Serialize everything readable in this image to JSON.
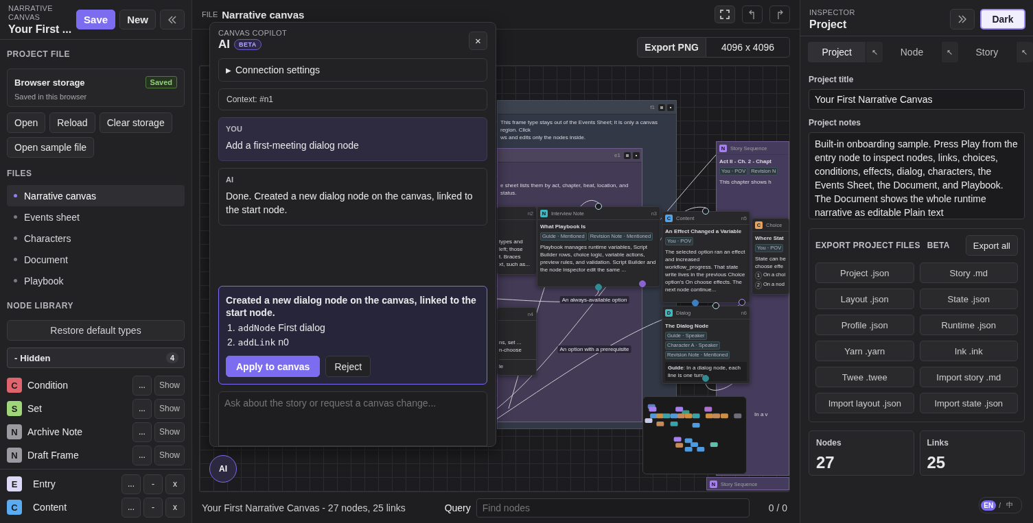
{
  "sidebar": {
    "app_label": "NARRATIVE CANVAS",
    "project_name": "Your First ...",
    "buttons": [
      {
        "label": "Save",
        "kind": "primary"
      },
      {
        "label": "New",
        "kind": "plain"
      }
    ]
  },
  "project_file": {
    "heading": "PROJECT FILE",
    "storage_title": "Browser storage",
    "storage_status": "Saved",
    "storage_note": "Saved in this browser",
    "actions": [
      "Open",
      "Reload",
      "Clear storage",
      "Open sample file"
    ]
  },
  "files": {
    "heading": "FILES",
    "items": [
      {
        "label": "Narrative canvas",
        "selected": true
      },
      {
        "label": "Events sheet",
        "selected": false
      },
      {
        "label": "Characters",
        "selected": false
      },
      {
        "label": "Document",
        "selected": false
      },
      {
        "label": "Playbook",
        "selected": false
      }
    ]
  },
  "node_library": {
    "heading": "NODE LIBRARY",
    "restore": "Restore default types",
    "hidden_group": {
      "toggle": "-",
      "label": "Hidden",
      "count": "4",
      "expanded": true
    },
    "hidden_types": [
      {
        "letter": "C",
        "name": "Condition",
        "color": "#e0646e",
        "more": "...",
        "action": "Show"
      },
      {
        "letter": "S",
        "name": "Set",
        "color": "#9fd67a",
        "more": "...",
        "action": "Show"
      },
      {
        "letter": "N",
        "name": "Archive Note",
        "color": "#9a9aa0",
        "more": "...",
        "action": "Show"
      },
      {
        "letter": "N",
        "name": "Draft Frame",
        "color": "#9a9aa0",
        "more": "...",
        "action": "Show"
      }
    ],
    "types": [
      {
        "letter": "E",
        "name": "Entry",
        "color": "#dcd9f6",
        "more": "...",
        "remove": "-",
        "delete": "x"
      },
      {
        "letter": "C",
        "name": "Content",
        "color": "#5aabf2",
        "more": "...",
        "remove": "-",
        "delete": "x"
      }
    ]
  },
  "center": {
    "file_label": "FILE",
    "file_name": "Narrative canvas",
    "export_button": "Export PNG",
    "export_size": "4096 x 4096",
    "canvas": {
      "frames": [
        {
          "kind": "region",
          "tag": "f1",
          "lines": [
            "This frame type stays out of the Events Sheet; it is only a canvas region. Click",
            "ws and edits only the nodes inside."
          ]
        },
        {
          "kind": "region",
          "tag": "e1",
          "lines": [
            "e sheet lists them by act, chapter, beat, location, and status."
          ]
        },
        {
          "kind": "sequence",
          "type": "Story Sequence",
          "letter": "N",
          "color": "#a77ff0",
          "title": "Act II - Ch. 2 - Chapt",
          "tags": [
            "You · POV",
            "Revision N"
          ],
          "lines": [
            "This chapter shows h"
          ],
          "footer": "In a v"
        },
        {
          "kind": "sequence",
          "type": "Story Sequence",
          "letter": "N",
          "color": "#a77ff0"
        }
      ],
      "nodes": [
        {
          "tag": "n2",
          "lines": [
            "types and",
            "left; those",
            "t. Braces",
            "xt, such as..."
          ]
        },
        {
          "tag": "n3",
          "letter": "N",
          "color": "#3fb8c2",
          "type": "Interview Note",
          "title": "What Playbook Is",
          "tags": [
            "Guide · Mentioned",
            "Revision Note · Mentioned"
          ],
          "body": "Playbook manages runtime variables, Script Builder rows, choice logic, variable actions, preview rules, and validation. Script Builder and the node inspector edit the same ..."
        },
        {
          "tag": "n5",
          "letter": "C",
          "color": "#4ea6f2",
          "type": "Content",
          "title": "An Effect Changed a Variable",
          "tags": [
            "You · POV"
          ],
          "body": "The selected option ran an effect and increased workflow_progress. That state write lives in the previous Choice option's On choose effects. The next node continue..."
        },
        {
          "letter": "C",
          "color": "#e5a263",
          "type": "Choice",
          "title": "Where Stat",
          "tags": [
            "You · POV"
          ],
          "lines": [
            "State can be",
            "choose effe"
          ],
          "options": [
            {
              "number": "1",
              "text": "On a choi"
            },
            {
              "number": "2",
              "text": "On a nod"
            }
          ]
        },
        {
          "tag": "n4",
          "lines": [
            "ns, set ...",
            "n-choose"
          ],
          "footer": "le"
        },
        {
          "tag": "n6",
          "letter": "D",
          "color": "#3fb8c2",
          "type": "Dialog",
          "title": "The Dialog Node",
          "tags": [
            "Guide · Speaker",
            "Character A · Speaker",
            "Revision Note · Mentioned"
          ],
          "dialog_line": "**Guide**: In a dialog node, each line is one turn."
        }
      ],
      "link_labels": [
        "An always-available option",
        "An option with a prerequisite"
      ]
    },
    "status": {
      "summary": "Your First Narrative Canvas - 27 nodes, 25 links",
      "query_label": "Query",
      "query_placeholder": "Find nodes",
      "match_count": "0 / 0"
    }
  },
  "copilot": {
    "eyebrow": "CANVAS COPILOT",
    "title": "AI",
    "badge": "BETA",
    "close": "×",
    "settings_marker": "▶",
    "settings_label": "Connection settings",
    "context": "Context: #n1",
    "messages": [
      {
        "kind": "user",
        "author": "YOU",
        "text": "Add a first-meeting dialog node"
      },
      {
        "kind": "assistant",
        "author": "AI",
        "text": "Done. Created a new dialog node on the canvas, linked to the start node."
      }
    ],
    "proposal": {
      "summary": "Created a new dialog node on the canvas, linked to the start node.",
      "steps": [
        {
          "number": "1.",
          "op": "addNode",
          "arg": "First dialog"
        },
        {
          "number": "2.",
          "op": "addLink",
          "arg": "n0"
        }
      ],
      "apply": "Apply to canvas",
      "reject": "Reject"
    },
    "input_placeholder": "Ask about the story or request a canvas change...",
    "launcher": "AI"
  },
  "inspector": {
    "eyebrow": "INSPECTOR",
    "title": "Project",
    "theme_button": "Dark",
    "tabs": [
      {
        "label": "Project",
        "selected": true,
        "popout": "↖"
      },
      {
        "label": "Node",
        "selected": false,
        "popout": "↖"
      },
      {
        "label": "Story",
        "selected": false,
        "popout": "↖"
      }
    ],
    "title_label": "Project title",
    "title_value": "Your First Narrative Canvas",
    "notes_label": "Project notes",
    "notes_value": "Built-in onboarding sample. Press Play from the entry node to inspect nodes, links, choices, conditions, effects, dialog, characters, the Events Sheet, the Document, and Playbook. The Document shows the whole runtime narrative as editable Plain text",
    "export": {
      "heading": "EXPORT PROJECT FILES",
      "badge": "BETA",
      "all": "Export all",
      "files": [
        "Project .json",
        "Story .md",
        "Layout .json",
        "State .json",
        "Profile .json",
        "Runtime .json",
        "Yarn .yarn",
        "Ink .ink",
        "Twee .twee",
        "Import story .md",
        "Import layout .json",
        "Import state .json"
      ]
    },
    "stats": [
      {
        "label": "Nodes",
        "value": "27"
      },
      {
        "label": "Links",
        "value": "25"
      }
    ],
    "language": {
      "separator": "/",
      "options": [
        {
          "label": "EN",
          "selected": true
        },
        {
          "label": "中",
          "selected": false
        }
      ]
    }
  }
}
